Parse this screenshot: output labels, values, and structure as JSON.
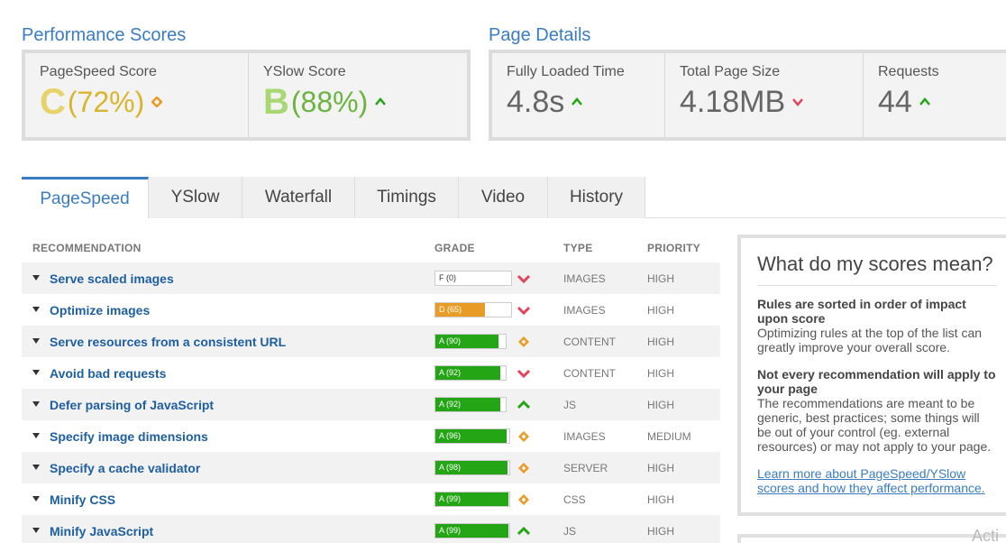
{
  "performance": {
    "title": "Performance Scores",
    "pagespeed": {
      "label": "PageSpeed Score",
      "grade": "C",
      "pct": "(72%)",
      "trend": "diamond",
      "color": "#d9b52f"
    },
    "yslow": {
      "label": "YSlow Score",
      "grade": "B",
      "pct": "(88%)",
      "trend": "up",
      "color": "#8cc63f"
    }
  },
  "details": {
    "title": "Page Details",
    "loaded": {
      "label": "Fully Loaded Time",
      "value": "4.8s",
      "trend": "up"
    },
    "size": {
      "label": "Total Page Size",
      "value": "4.18MB",
      "trend": "down"
    },
    "requests": {
      "label": "Requests",
      "value": "44",
      "trend": "up"
    }
  },
  "tabs": [
    "PageSpeed",
    "YSlow",
    "Waterfall",
    "Timings",
    "Video",
    "History"
  ],
  "table": {
    "headers": {
      "recommendation": "RECOMMENDATION",
      "grade": "GRADE",
      "type": "TYPE",
      "priority": "PRIORITY"
    },
    "rows": [
      {
        "rec": "Serve scaled images",
        "grade": "F (0)",
        "score": 0,
        "indicator": "down",
        "type": "IMAGES",
        "priority": "HIGH"
      },
      {
        "rec": "Optimize images",
        "grade": "D (65)",
        "score": 65,
        "indicator": "down",
        "type": "IMAGES",
        "priority": "HIGH"
      },
      {
        "rec": "Serve resources from a consistent URL",
        "grade": "A (90)",
        "score": 90,
        "indicator": "diamond",
        "type": "CONTENT",
        "priority": "HIGH"
      },
      {
        "rec": "Avoid bad requests",
        "grade": "A (92)",
        "score": 92,
        "indicator": "down",
        "type": "CONTENT",
        "priority": "HIGH"
      },
      {
        "rec": "Defer parsing of JavaScript",
        "grade": "A (92)",
        "score": 92,
        "indicator": "up",
        "type": "JS",
        "priority": "HIGH"
      },
      {
        "rec": "Specify image dimensions",
        "grade": "A (96)",
        "score": 96,
        "indicator": "diamond",
        "type": "IMAGES",
        "priority": "MEDIUM"
      },
      {
        "rec": "Specify a cache validator",
        "grade": "A (98)",
        "score": 98,
        "indicator": "diamond",
        "type": "SERVER",
        "priority": "HIGH"
      },
      {
        "rec": "Minify CSS",
        "grade": "A (99)",
        "score": 99,
        "indicator": "diamond",
        "type": "CSS",
        "priority": "HIGH"
      },
      {
        "rec": "Minify JavaScript",
        "grade": "A (99)",
        "score": 99,
        "indicator": "up",
        "type": "JS",
        "priority": "HIGH"
      }
    ]
  },
  "info": {
    "title": "What do my scores mean?",
    "p1_bold": "Rules are sorted in order of impact upon score",
    "p1_text": "Optimizing rules at the top of the list can greatly improve your overall score.",
    "p2_bold": "Not every recommendation will apply to your page",
    "p2_text": "The recommendations are meant to be generic, best practices; some things will be out of your control (eg. external resources) or may not apply to your page.",
    "link": "Learn more about PageSpeed/YSlow scores and how they affect performance."
  },
  "watermark": "Acti",
  "colors": {
    "green": "#23a515",
    "orange": "#e89c25",
    "red": "#e2445c",
    "up": "#23a515",
    "blue": "#3a7cc0"
  }
}
